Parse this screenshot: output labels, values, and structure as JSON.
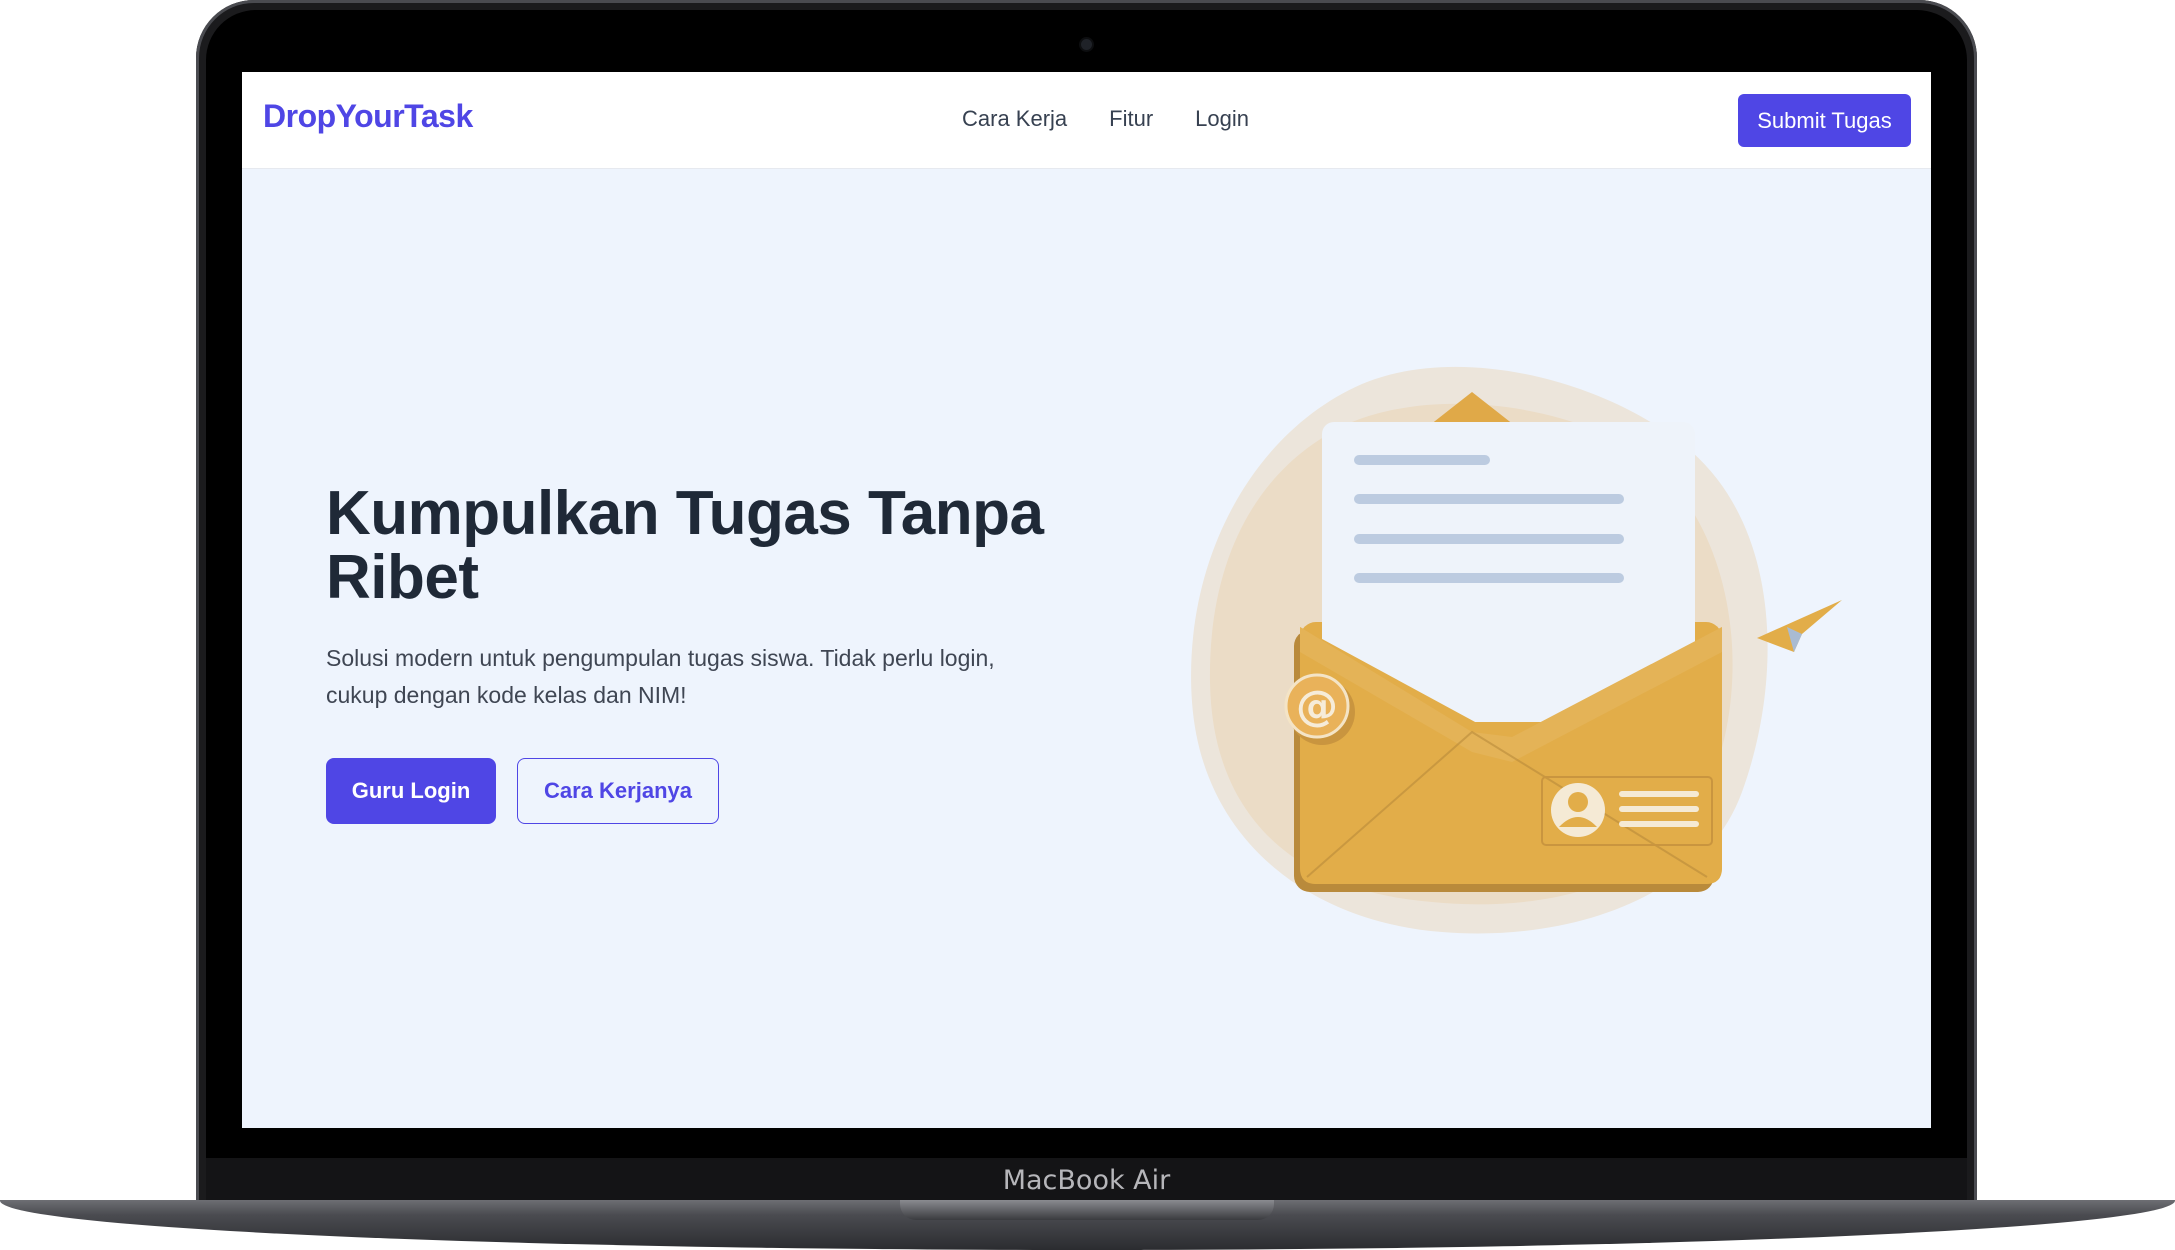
{
  "device": {
    "model": "MacBook Air"
  },
  "navbar": {
    "brand": "DropYourTask",
    "links": [
      "Cara Kerja",
      "Fitur",
      "Login"
    ],
    "cta": "Submit Tugas"
  },
  "hero": {
    "title": "Kumpulkan Tugas Tanpa Ribet",
    "subtitle": "Solusi modern untuk pengumpulan tugas siswa. Tidak perlu login, cukup dengan kode kelas dan NIM!",
    "primary_button": "Guru Login",
    "secondary_button": "Cara Kerjanya"
  },
  "colors": {
    "accent": "#4f46e5",
    "hero_bg": "#eef4fd",
    "envelope": "#e2ad49",
    "title_text": "#1f2937"
  }
}
